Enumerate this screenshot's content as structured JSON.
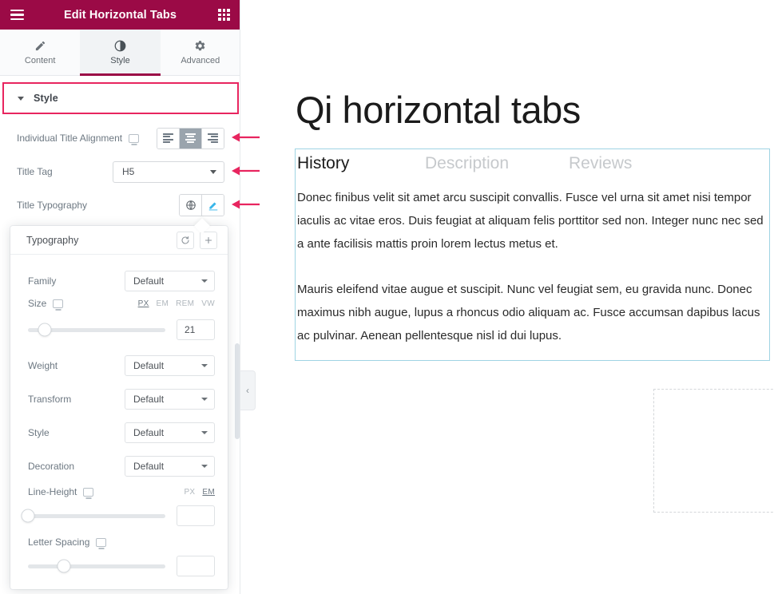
{
  "panel": {
    "header": {
      "title": "Edit Horizontal Tabs",
      "menu_icon": "hamburger-icon",
      "grid_icon": "apps-grid-icon",
      "bg_color": "#9b0a46"
    },
    "tabs": [
      {
        "label": "Content",
        "icon": "pencil-icon",
        "active": false
      },
      {
        "label": "Style",
        "icon": "contrast-circle-icon",
        "active": true
      },
      {
        "label": "Advanced",
        "icon": "gear-icon",
        "active": false
      }
    ],
    "section": {
      "label": "Style",
      "collapsed": false,
      "highlight_color": "#e8255f"
    },
    "controls": {
      "alignment": {
        "label": "Individual Title Alignment",
        "responsive_icon": "monitor-icon",
        "options": [
          "align-left",
          "align-center",
          "align-right"
        ],
        "selected": "align-center"
      },
      "title_tag": {
        "label": "Title Tag",
        "value": "H5"
      },
      "title_typography": {
        "label": "Title Typography",
        "global_icon": "globe-icon",
        "edit_icon": "pencil-edit-icon",
        "edit_active": true
      }
    },
    "collapse_handle": {
      "icon": "chevron-left-icon"
    },
    "annotation_arrows": 3,
    "annotation_color": "#e8255f"
  },
  "typography_popover": {
    "title": "Typography",
    "reset_icon": "reset-icon",
    "add_icon": "plus-icon",
    "fields": [
      {
        "name": "family",
        "label": "Family",
        "value": "Default"
      },
      {
        "name": "weight",
        "label": "Weight",
        "value": "Default"
      },
      {
        "name": "transform",
        "label": "Transform",
        "value": "Default"
      },
      {
        "name": "style",
        "label": "Style",
        "value": "Default"
      },
      {
        "name": "decoration",
        "label": "Decoration",
        "value": "Default"
      }
    ],
    "size": {
      "label": "Size",
      "responsive_icon": "monitor-icon",
      "units": [
        "PX",
        "EM",
        "REM",
        "VW"
      ],
      "active_unit": "PX",
      "value": "21",
      "slider_percent": 12
    },
    "line_height": {
      "label": "Line-Height",
      "responsive_icon": "monitor-icon",
      "units": [
        "PX",
        "EM"
      ],
      "active_unit": "EM",
      "value": "",
      "slider_percent": 0
    },
    "letter_spacing": {
      "label": "Letter Spacing",
      "responsive_icon": "monitor-icon",
      "value": "",
      "slider_percent": 26
    }
  },
  "preview": {
    "page_title": "Qi horizontal tabs",
    "widget": {
      "border_color": "#9fd4e3",
      "tabs": [
        {
          "label": "History",
          "active": true
        },
        {
          "label": "Description",
          "active": false
        },
        {
          "label": "Reviews",
          "active": false
        }
      ],
      "content_paragraphs": [
        "Donec finibus velit sit amet arcu suscipit convallis. Fusce vel urna sit amet nisi tempor iaculis ac vitae eros. Duis feugiat at aliquam felis porttitor sed non. Integer nunc nec sed a ante facilisis mattis proin lorem lectus metus et.",
        "Mauris eleifend vitae augue et suscipit. Nunc vel feugiat sem, eu gravida nunc. Donec maximus nibh augue, lupus a rhoncus odio aliquam ac. Fusce accumsan dapibus lacus ac pulvinar. Aenean pellentesque nisl id dui lupus."
      ]
    },
    "placeholder_box": "empty-section-placeholder"
  }
}
